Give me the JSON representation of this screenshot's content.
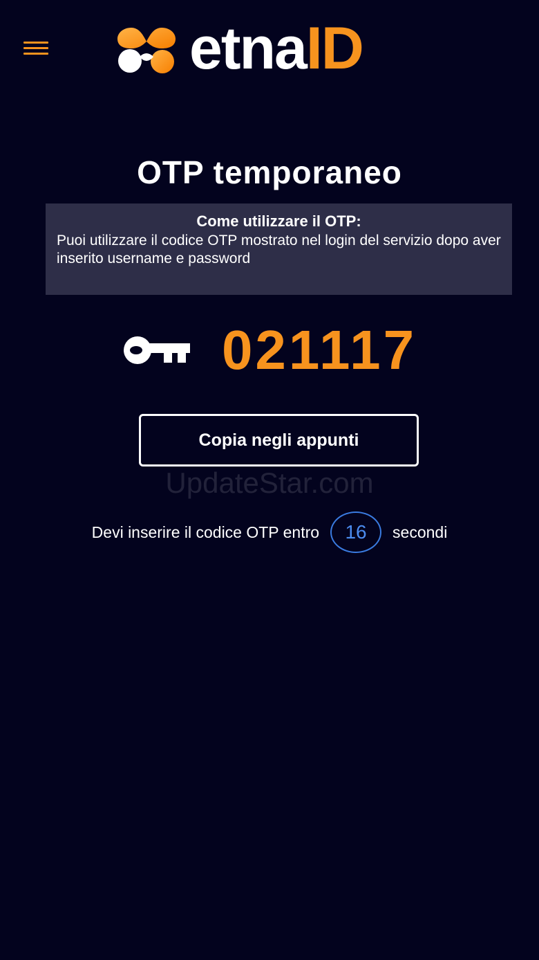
{
  "header": {
    "logo_word": "etna",
    "logo_suffix": "ID",
    "menu_icon": "hamburger-menu-icon",
    "brand_color": "#f7931e"
  },
  "main": {
    "title": "OTP temporaneo",
    "info": {
      "heading": "Come utilizzare il OTP:",
      "text": "Puoi utilizzare il codice OTP mostrato nel login del servizio dopo aver inserito username e password"
    },
    "otp": {
      "icon": "key-icon",
      "code": "021117"
    },
    "copy_button_label": "Copia negli appunti",
    "watermark": "UpdateStar.com",
    "timer": {
      "prefix": "Devi inserire il codice OTP entro",
      "seconds": "16",
      "suffix": "secondi",
      "ring_color": "#3a7be0"
    }
  }
}
